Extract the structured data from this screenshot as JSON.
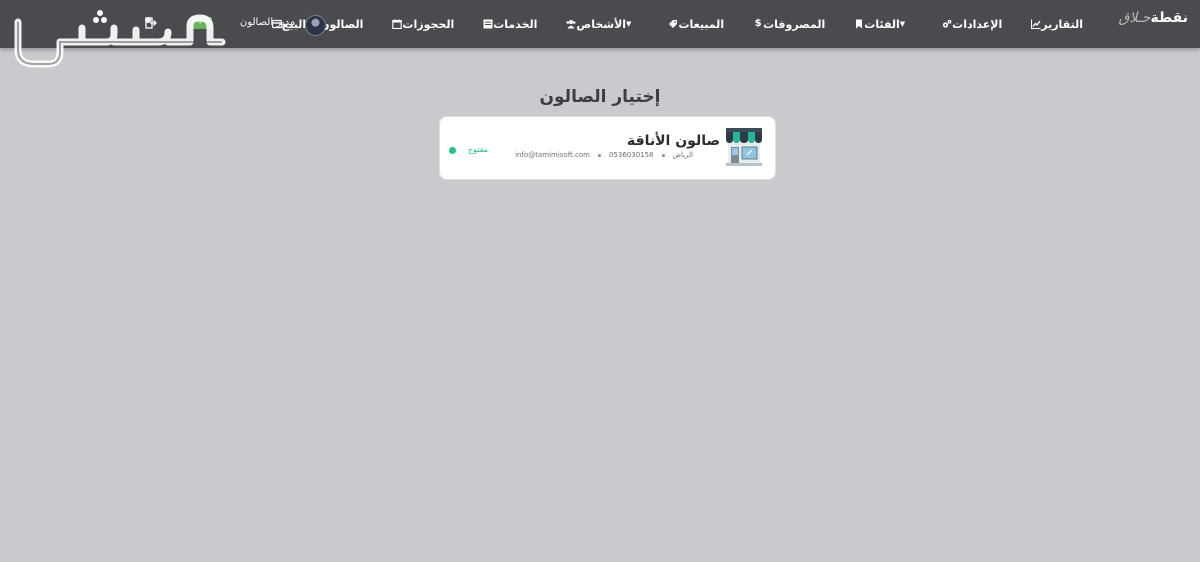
{
  "brand": {
    "part_bold": "نقطة",
    "part_light": "حـلاق"
  },
  "nav": {
    "items": [
      {
        "label": "البيع",
        "icon": "credit-card-icon"
      },
      {
        "label": "الصالون",
        "icon": "building-icon"
      },
      {
        "label": "الحجوزات",
        "icon": "calendar-icon"
      },
      {
        "label": "الخدمات",
        "icon": "list-icon"
      },
      {
        "label": "الأشخاص",
        "icon": "users-icon",
        "dropdown": true
      },
      {
        "label": "المبيعات",
        "icon": "tags-icon"
      },
      {
        "label": "المصروفات",
        "icon": "dollar-icon"
      },
      {
        "label": "الفئات",
        "icon": "bookmark-icon",
        "dropdown": true
      },
      {
        "label": "الإعدادات",
        "icon": "cogs-icon"
      },
      {
        "label": "التقارير",
        "icon": "chart-icon"
      }
    ],
    "user_name": "مدير الصالون"
  },
  "watermark": {
    "text": "مستقل",
    "icon": "mostaql-logo"
  },
  "main": {
    "title": "إختيار الصالون",
    "salon": {
      "name": "صالون الأناقة",
      "city": "الرياض",
      "phone": "0536030158",
      "email": "info@tamimisoft.com",
      "status": "مفتوح",
      "status_color": "#1fbf8f",
      "icon": "shop-icon"
    }
  },
  "colors": {
    "navbar": "#4a4b4f",
    "background": "#c9c9ce",
    "accent": "#1fbf8f"
  }
}
